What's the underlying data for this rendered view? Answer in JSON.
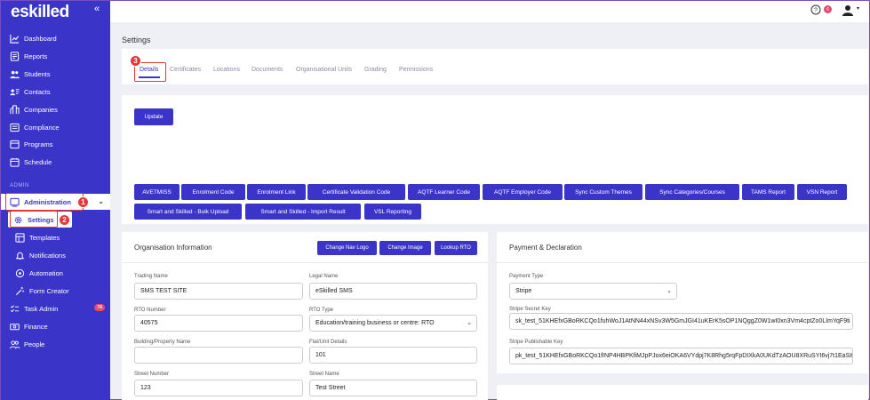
{
  "app": {
    "logo": "eskilled",
    "collapse_icon": "double-chevron-left-icon"
  },
  "sidebar": {
    "items": [
      {
        "label": "Dashboard",
        "icon": "chart-line-icon"
      },
      {
        "label": "Reports",
        "icon": "report-icon"
      },
      {
        "label": "Students",
        "icon": "users-icon"
      },
      {
        "label": "Contacts",
        "icon": "contact-card-icon"
      },
      {
        "label": "Companies",
        "icon": "building-icon"
      },
      {
        "label": "Compliance",
        "icon": "checklist-icon"
      },
      {
        "label": "Programs",
        "icon": "programs-icon"
      },
      {
        "label": "Schedule",
        "icon": "calendar-icon"
      }
    ],
    "section_label": "ADMIN",
    "admin_label": "Administration",
    "admin_sub": [
      {
        "label": "Settings",
        "icon": "gear-icon"
      },
      {
        "label": "Templates",
        "icon": "template-icon"
      },
      {
        "label": "Notifications",
        "icon": "bell-icon"
      },
      {
        "label": "Automation",
        "icon": "automation-icon"
      },
      {
        "label": "Form Creator",
        "icon": "magic-wand-icon"
      }
    ],
    "task_admin_label": "Task Admin",
    "task_admin_badge": "76",
    "finance_label": "Finance",
    "people_label": "People"
  },
  "annotations": [
    "1",
    "2",
    "3"
  ],
  "topbar": {
    "notification_count": "6"
  },
  "page_title": "Settings",
  "tabs": [
    "Details",
    "Certificates",
    "Locations",
    "Documents",
    "Organisational Units",
    "Grading",
    "Permissions"
  ],
  "update_button": "Update",
  "action_buttons_row1": [
    "AVETMISS",
    "Enrolment Code",
    "Enrolment Link",
    "Certificate Validation Code",
    "AQTF Learner Code",
    "AQTF Employer Code",
    "Sync Custom Themes",
    "Sync Categories/Courses",
    "TAMS Report",
    "VSN Report"
  ],
  "action_buttons_row2": [
    "Smart and Skilled - Bulk Upload",
    "Smart and Skilled - Import Result",
    "VSL Reporting"
  ],
  "org_info": {
    "title": "Organisation Information",
    "buttons": [
      "Change Nav Logo",
      "Change Image",
      "Lookup RTO"
    ],
    "trading_name_label": "Trading Name",
    "trading_name": "SMS TEST SITE",
    "legal_name_label": "Legal Name",
    "legal_name": "eSkilled SMS",
    "rto_number_label": "RTO Number",
    "rto_number": "40575",
    "rto_type_label": "RTO Type",
    "rto_type": "Education/training business or centre: RTO",
    "building_label": "Building/Property Name",
    "building": "",
    "flat_label": "Flat/Unit Details",
    "flat": "101",
    "street_number_label": "Street Number",
    "street_number": "123",
    "street_name_label": "Street Name",
    "street_name": "Test Street"
  },
  "payment": {
    "title": "Payment & Declaration",
    "payment_type_label": "Payment Type",
    "payment_type": "Stripe",
    "secret_key_label": "Stripe Secret Key",
    "secret_key": "sk_test_51KHEfxGBoRKCQo1fuhWoJ1AtNN44xNSv3W5GmJGI41uKErK5sOP1NQggZ0W1wI0xn3Vm4cptZo0LImYqF9ti",
    "publishable_key_label": "Stripe Publishable Key",
    "publishable_key": "pk_test_51KHEfxGBoRKCQo1fINP4HBPKfiMJpPJox6eiOKA6VYdpj7K8Rhg5rqFpDIXkA0UKdTzAOU8XRuSYI6vj7t1EaSIt"
  }
}
